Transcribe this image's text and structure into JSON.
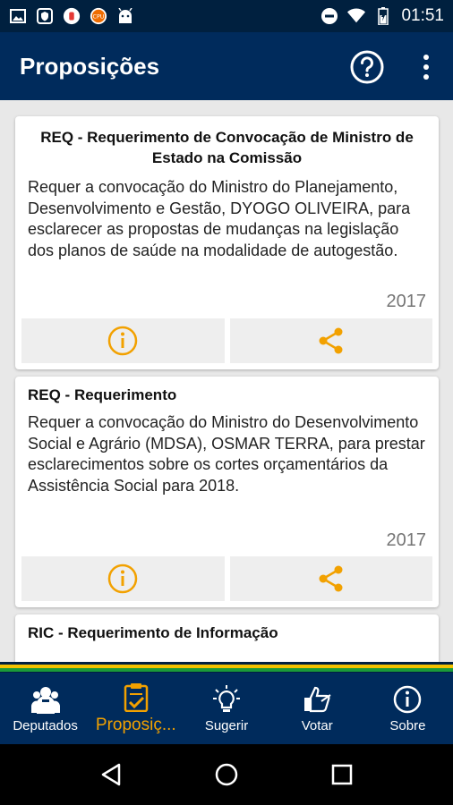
{
  "status_bar": {
    "time": "01:51",
    "left_icons": [
      "image-icon",
      "shield-icon",
      "notification-badge-icon",
      "cpu-icon",
      "android-icon"
    ],
    "right_icons": [
      "do-not-disturb-icon",
      "wifi-icon",
      "battery-icon"
    ]
  },
  "app_bar": {
    "title": "Proposições",
    "help_icon": "help-circle-icon",
    "menu_icon": "more-vert-icon"
  },
  "cards": [
    {
      "title": "REQ  - Requerimento de Convocação de Ministro de Estado na Comissão",
      "body": "Requer a convocação do Ministro do Planejamento, Desenvolvimento e Gestão, DYOGO OLIVEIRA, para esclarecer as propostas de mudanças na legislação dos planos de saúde na modalidade de autogestão.",
      "year": "2017"
    },
    {
      "title": "REQ  - Requerimento",
      "body": "Requer a convocação do Ministro do Desenvolvimento Social e Agrário (MDSA), OSMAR TERRA, para prestar esclarecimentos sobre os cortes orçamentários da Assistência Social para 2018.",
      "year": "2017"
    },
    {
      "title": "RIC  - Requerimento de Informação"
    }
  ],
  "bottom_nav": [
    {
      "label": "Deputados",
      "icon": "group-icon"
    },
    {
      "label": "Proposiç...",
      "icon": "clipboard-check-icon",
      "active": true
    },
    {
      "label": "Sugerir",
      "icon": "lightbulb-icon"
    },
    {
      "label": "Votar",
      "icon": "thumbs-up-icon"
    },
    {
      "label": "Sobre",
      "icon": "info-icon"
    }
  ],
  "system_nav": [
    "back-icon",
    "home-icon",
    "recents-icon"
  ],
  "colors": {
    "primary": "#002b5c",
    "status_bar": "#00203f",
    "accent": "#f2a100"
  }
}
